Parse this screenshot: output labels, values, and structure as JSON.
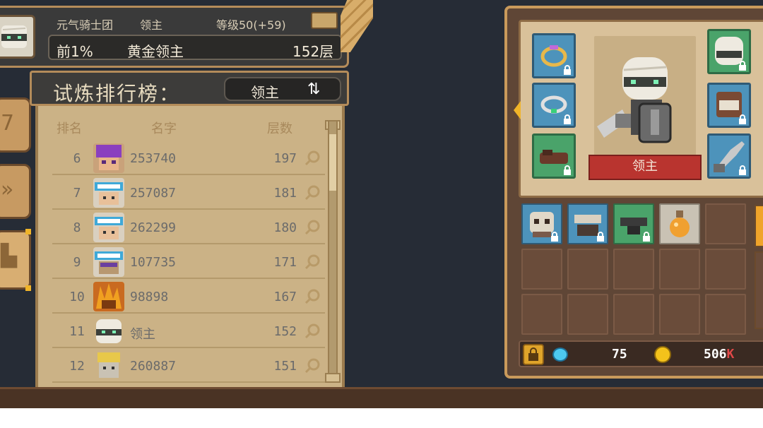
{
  "header": {
    "guild": "元气骑士团",
    "role": "领主",
    "level": "等级50(+59)",
    "percentile": "前1%",
    "rank_title": "黄金领主",
    "floor": "152层"
  },
  "leaderboard": {
    "title": "试炼排行榜：",
    "mode_label": "领主",
    "columns": {
      "rank": "排名",
      "name": "名字",
      "floors": "层数"
    },
    "rows": [
      {
        "rank": "6",
        "name": "253740",
        "floors": "197",
        "avatar": "purple-hair-hero"
      },
      {
        "rank": "7",
        "name": "257087",
        "floors": "181",
        "avatar": "goggles-hero"
      },
      {
        "rank": "8",
        "name": "262299",
        "floors": "180",
        "avatar": "goggles-hero"
      },
      {
        "rank": "9",
        "name": "107735",
        "floors": "171",
        "avatar": "goggles-purple-hero"
      },
      {
        "rank": "10",
        "name": "98898",
        "floors": "167",
        "avatar": "flame-hero"
      },
      {
        "rank": "11",
        "name": "领主",
        "floors": "152",
        "avatar": "bandage-lord"
      },
      {
        "rank": "12",
        "name": "260887",
        "floors": "151",
        "avatar": "blond-hero"
      }
    ]
  },
  "equipment": {
    "character_name": "领主",
    "currency": {
      "gems": "75",
      "gold": "506",
      "gold_suffix": "K"
    }
  },
  "colors": {
    "ribbon": "#b9342f",
    "slot_blue": "#4d93bb",
    "slot_green": "#4aa36a",
    "panel_tan": "#cbb286",
    "accent_gold": "#f0b429"
  }
}
